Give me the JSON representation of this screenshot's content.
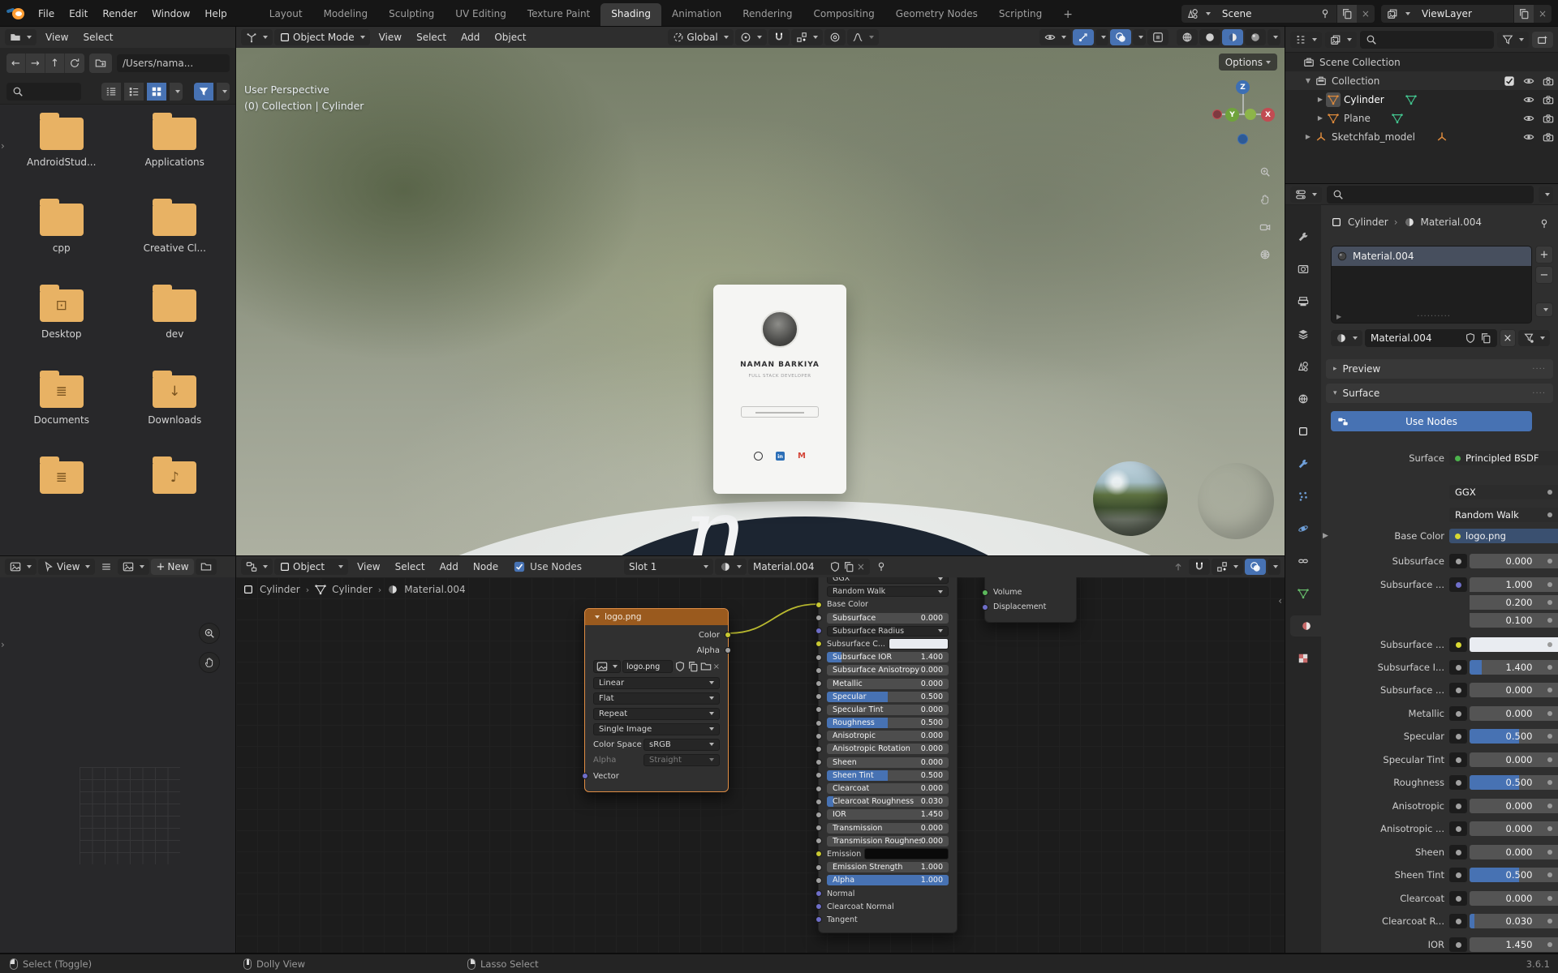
{
  "topbar": {
    "menus": [
      "File",
      "Edit",
      "Render",
      "Window",
      "Help"
    ],
    "tabs": [
      "Layout",
      "Modeling",
      "Sculpting",
      "UV Editing",
      "Texture Paint",
      "Shading",
      "Animation",
      "Rendering",
      "Compositing",
      "Geometry Nodes",
      "Scripting"
    ],
    "active_tab": "Shading",
    "add_tab_label": "+",
    "scene_label": "Scene",
    "viewlayer_label": "ViewLayer"
  },
  "file_browser": {
    "menus": [
      "View",
      "Select"
    ],
    "path_value": "/Users/nama...",
    "folders": [
      {
        "label": "AndroidStud...",
        "glyph": ""
      },
      {
        "label": "Applications",
        "glyph": ""
      },
      {
        "label": "cpp",
        "glyph": ""
      },
      {
        "label": "Creative Cl...",
        "glyph": ""
      },
      {
        "label": "Desktop",
        "glyph": "desktop"
      },
      {
        "label": "dev",
        "glyph": ""
      },
      {
        "label": "Documents",
        "glyph": "lines"
      },
      {
        "label": "Downloads",
        "glyph": "down"
      },
      {
        "label": "",
        "glyph": "lines"
      },
      {
        "label": "",
        "glyph": "music"
      }
    ]
  },
  "image_editor": {
    "view_menu": "View",
    "new_button": "New"
  },
  "viewport": {
    "mode_label": "Object Mode",
    "menus": [
      "View",
      "Select",
      "Add",
      "Object"
    ],
    "orientation_label": "Global",
    "options_button": "Options",
    "overlay_line1": "User Perspective",
    "overlay_line2": "(0) Collection | Cylinder",
    "axis_labels": {
      "z": "Z",
      "y": "Y",
      "x": "X"
    },
    "card": {
      "name": "NAMAN BARKIYA",
      "subtitle": "FULL STACK DEVELOPER",
      "linkedin_glyph": "in",
      "gmail_glyph": "M"
    },
    "platform_letter": "n"
  },
  "shader_editor": {
    "type_label": "Object",
    "menus": [
      "View",
      "Select",
      "Add",
      "Node"
    ],
    "use_nodes_label": "Use Nodes",
    "slot_label": "Slot 1",
    "material_name": "Material.004",
    "breadcrumb": [
      {
        "label": "Cylinder",
        "icon": "object"
      },
      {
        "label": "Cylinder",
        "icon": "mesh-white"
      },
      {
        "label": "Material.004",
        "icon": "matsphere"
      }
    ],
    "image_node": {
      "title": "logo.png",
      "outputs": [
        {
          "name": "Color",
          "color": "#c8c832"
        },
        {
          "name": "Alpha",
          "color": "#a1a1a1"
        }
      ],
      "image_value": "logo.png",
      "dropdowns": [
        "Linear",
        "Flat",
        "Repeat",
        "Single Image"
      ],
      "color_space_label": "Color Space",
      "color_space_value": "sRGB",
      "alpha_label": "Alpha",
      "alpha_value": "Straight",
      "input_name": "Vector",
      "input_color": "#6e6ec8"
    },
    "bsdf_node": {
      "dropdowns": [
        "GGX",
        "Random Walk"
      ],
      "rows": [
        {
          "label": "Base Color",
          "kind": "input",
          "socket": "#c8c832"
        },
        {
          "label": "Subsurface",
          "kind": "slider",
          "value": "0.000",
          "fill": 0,
          "socket": "#a1a1a1"
        },
        {
          "label": "Subsurface Radius",
          "kind": "dropdown",
          "socket": "#6e6ec8"
        },
        {
          "label": "Subsurface C...",
          "kind": "color",
          "swatch": "#e9ecf1",
          "socket": "#c8c832"
        },
        {
          "label": "Subsurface IOR",
          "kind": "slider",
          "value": "1.400",
          "fill": 0.12,
          "socket": "#a1a1a1"
        },
        {
          "label": "Subsurface Anisotropy",
          "kind": "slider",
          "value": "0.000",
          "fill": 0,
          "socket": "#a1a1a1"
        },
        {
          "label": "Metallic",
          "kind": "slider",
          "value": "0.000",
          "fill": 0,
          "socket": "#a1a1a1"
        },
        {
          "label": "Specular",
          "kind": "slider",
          "value": "0.500",
          "fill": 0.5,
          "socket": "#a1a1a1"
        },
        {
          "label": "Specular Tint",
          "kind": "slider",
          "value": "0.000",
          "fill": 0,
          "socket": "#a1a1a1"
        },
        {
          "label": "Roughness",
          "kind": "slider",
          "value": "0.500",
          "fill": 0.5,
          "socket": "#a1a1a1"
        },
        {
          "label": "Anisotropic",
          "kind": "slider",
          "value": "0.000",
          "fill": 0,
          "socket": "#a1a1a1"
        },
        {
          "label": "Anisotropic Rotation",
          "kind": "slider",
          "value": "0.000",
          "fill": 0,
          "socket": "#a1a1a1"
        },
        {
          "label": "Sheen",
          "kind": "slider",
          "value": "0.000",
          "fill": 0,
          "socket": "#a1a1a1"
        },
        {
          "label": "Sheen Tint",
          "kind": "slider",
          "value": "0.500",
          "fill": 0.5,
          "socket": "#a1a1a1"
        },
        {
          "label": "Clearcoat",
          "kind": "slider",
          "value": "0.000",
          "fill": 0,
          "socket": "#a1a1a1"
        },
        {
          "label": "Clearcoat Roughness",
          "kind": "slider",
          "value": "0.030",
          "fill": 0.05,
          "socket": "#a1a1a1"
        },
        {
          "label": "IOR",
          "kind": "slider",
          "value": "1.450",
          "fill": 0,
          "socket": "#a1a1a1"
        },
        {
          "label": "Transmission",
          "kind": "slider",
          "value": "0.000",
          "fill": 0,
          "socket": "#a1a1a1"
        },
        {
          "label": "Transmission Roughness",
          "kind": "slider",
          "value": "0.000",
          "fill": 0,
          "socket": "#a1a1a1"
        },
        {
          "label": "Emission",
          "kind": "color",
          "swatch": "#0a0a0a",
          "socket": "#c8c832"
        },
        {
          "label": "Emission Strength",
          "kind": "slider",
          "value": "1.000",
          "fill": 0,
          "socket": "#a1a1a1"
        },
        {
          "label": "Alpha",
          "kind": "slider",
          "value": "1.000",
          "fill": 1,
          "socket": "#a1a1a1"
        },
        {
          "label": "Normal",
          "kind": "input",
          "socket": "#6e6ec8"
        },
        {
          "label": "Clearcoat Normal",
          "kind": "input",
          "socket": "#6e6ec8"
        },
        {
          "label": "Tangent",
          "kind": "input",
          "socket": "#6e6ec8"
        }
      ]
    },
    "output_node": {
      "inputs": [
        {
          "name": "Volume",
          "color": "#5cb85c"
        },
        {
          "name": "Displacement",
          "color": "#6e6ec8"
        }
      ]
    }
  },
  "outliner": {
    "items": [
      {
        "name": "Scene Collection",
        "icon": "collection",
        "depth": 0,
        "disclosure": "",
        "toggles": []
      },
      {
        "name": "Collection",
        "icon": "collection",
        "depth": 1,
        "disclosure": "▼",
        "toggles": [
          "checkbox",
          "eye",
          "camera"
        ],
        "hl": true
      },
      {
        "name": "Cylinder",
        "icon": "mesh-orange",
        "depth": 2,
        "disclosure": "▶",
        "data_icon": "mesh-green",
        "selected": true,
        "toggles": [
          "eye",
          "camera"
        ]
      },
      {
        "name": "Plane",
        "icon": "mesh-orange",
        "depth": 2,
        "disclosure": "▶",
        "data_icon": "mesh-green",
        "toggles": [
          "eye",
          "camera"
        ]
      },
      {
        "name": "Sketchfab_model",
        "icon": "empty-orange",
        "depth": 1,
        "disclosure": "▶",
        "data_icon": "empty-orange",
        "toggles": [
          "eye",
          "camera"
        ]
      }
    ]
  },
  "properties": {
    "breadcrumb": {
      "object": "Cylinder",
      "material": "Material.004"
    },
    "slot_item": "Material.004",
    "name_value": "Material.004",
    "preview_panel": "Preview",
    "surface_panel": "Surface",
    "use_nodes_button": "Use Nodes",
    "tab_icons": [
      "tool",
      "render",
      "output",
      "view-layer",
      "scene",
      "world",
      "object",
      "modifiers",
      "particles",
      "physics",
      "constraints",
      "data",
      "material",
      "texture"
    ],
    "active_tab": "material",
    "rows": [
      {
        "label": "Surface",
        "kind": "menu",
        "value": "Principled BSDF",
        "dot": "#4cb34c",
        "anim": false
      },
      {
        "label": "",
        "kind": "dropdown",
        "value": "GGX",
        "anim": true
      },
      {
        "label": "",
        "kind": "dropdown",
        "value": "Random Walk",
        "anim": true
      },
      {
        "label": "Base Color",
        "kind": "image",
        "value": "logo.png",
        "dot": "#d8d832",
        "disclosure": true,
        "anim": false
      },
      {
        "label": "Subsurface",
        "kind": "slider",
        "value": "0.000",
        "fill": 0,
        "socket": "#a1a1a1",
        "anim": true
      },
      {
        "label": "Subsurface ...",
        "kind": "triple",
        "values": [
          "1.000",
          "0.200",
          "0.100"
        ],
        "socket": "#6e6ec8",
        "anim": true
      },
      {
        "label": "Subsurface ...",
        "kind": "color",
        "swatch": "#e9ecf1",
        "socket": "#d8d832",
        "anim": true
      },
      {
        "label": "Subsurface I...",
        "kind": "slider",
        "value": "1.400",
        "fill": 0.12,
        "socket": "#a1a1a1",
        "anim": true
      },
      {
        "label": "Subsurface ...",
        "kind": "slider",
        "value": "0.000",
        "fill": 0,
        "socket": "#a1a1a1",
        "anim": true
      },
      {
        "label": "Metallic",
        "kind": "slider",
        "value": "0.000",
        "fill": 0,
        "socket": "#a1a1a1",
        "anim": true
      },
      {
        "label": "Specular",
        "kind": "slider",
        "value": "0.500",
        "fill": 0.5,
        "socket": "#a1a1a1",
        "anim": true
      },
      {
        "label": "Specular Tint",
        "kind": "slider",
        "value": "0.000",
        "fill": 0,
        "socket": "#a1a1a1",
        "anim": true
      },
      {
        "label": "Roughness",
        "kind": "slider",
        "value": "0.500",
        "fill": 0.5,
        "socket": "#a1a1a1",
        "anim": true
      },
      {
        "label": "Anisotropic",
        "kind": "slider",
        "value": "0.000",
        "fill": 0,
        "socket": "#a1a1a1",
        "anim": true
      },
      {
        "label": "Anisotropic ...",
        "kind": "slider",
        "value": "0.000",
        "fill": 0,
        "socket": "#a1a1a1",
        "anim": true
      },
      {
        "label": "Sheen",
        "kind": "slider",
        "value": "0.000",
        "fill": 0,
        "socket": "#a1a1a1",
        "anim": true
      },
      {
        "label": "Sheen Tint",
        "kind": "slider",
        "value": "0.500",
        "fill": 0.5,
        "socket": "#a1a1a1",
        "anim": true
      },
      {
        "label": "Clearcoat",
        "kind": "sl20ider",
        "value": "0.000",
        "fill": 0,
        "socket": "#a1a1a1",
        "anim": true
      },
      {
        "label": "Clearcoat R...",
        "kind": "slider",
        "value": "0.030",
        "fill": 0.05,
        "socket": "#a1a1a1",
        "anim": true
      },
      {
        "label": "IOR",
        "kind": "slider",
        "value": "1.450",
        "fill": 0,
        "socket": "#a1a1a1",
        "anim": true
      }
    ]
  },
  "statusbar": {
    "items": [
      {
        "label": "Select (Toggle)",
        "icon": "mouse-left"
      },
      {
        "label": "Dolly View",
        "icon": "mouse-middle"
      },
      {
        "label": "Lasso Select",
        "icon": "mouse-right"
      }
    ],
    "version": "3.6.1"
  },
  "icons_used": [
    "search-icon",
    "eye-icon",
    "camera-icon",
    "funnel-icon",
    "pin-icon",
    "shield-icon",
    "copy-icon",
    "close-icon",
    "chevron-down-icon",
    "magnet-icon",
    "checkbox-icon",
    "folder-icon",
    "refresh-icon",
    "hand-icon",
    "zoom-icon",
    "grid-icon",
    "nodes-icon",
    "mouse-icons"
  ]
}
